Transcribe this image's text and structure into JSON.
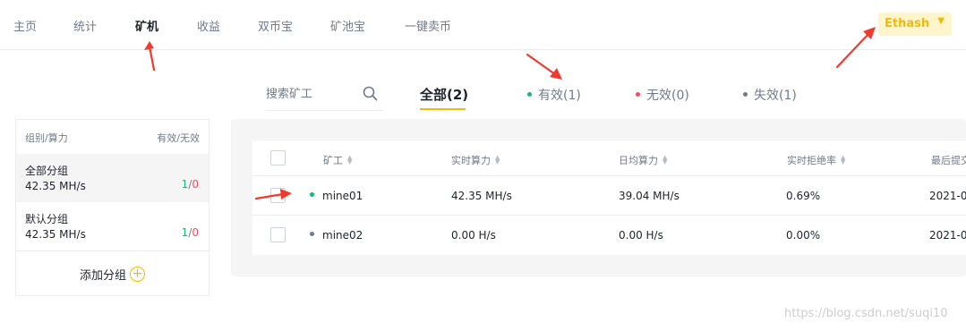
{
  "nav": {
    "items": [
      "主页",
      "统计",
      "矿机",
      "收益",
      "双币宝",
      "矿池宝",
      "一键卖币"
    ],
    "active": "矿机"
  },
  "algo_select": {
    "value": "Ethash"
  },
  "search": {
    "placeholder": "搜索矿工"
  },
  "filter_tabs": [
    {
      "label": "全部(2)",
      "active": true
    },
    {
      "label": "有效(1)",
      "dot_color": "#02c076"
    },
    {
      "label": "无效(0)",
      "dot_color": "#f84960"
    },
    {
      "label": "失效(1)",
      "dot_color": "#707a8a"
    }
  ],
  "groups": {
    "header_left": "组别/算力",
    "header_right": "有效/无效",
    "items": [
      {
        "name": "全部分组",
        "rate": "42.35 MH/s",
        "valid": "1",
        "sep": "/",
        "invalid": "0"
      },
      {
        "name": "默认分组",
        "rate": "42.35 MH/s",
        "valid": "1",
        "sep": "/",
        "invalid": "0"
      }
    ],
    "add_label": "添加分组"
  },
  "table": {
    "columns": [
      "矿工",
      "实时算力",
      "日均算力",
      "实时拒绝率",
      "最后提交"
    ],
    "rows": [
      {
        "worker": "mine01",
        "status_color": "#02c076",
        "realtime": "42.35 MH/s",
        "daily": "39.04 MH/s",
        "reject": "0.69%",
        "last": "2021-0"
      },
      {
        "worker": "mine02",
        "status_color": "#707a8a",
        "realtime": "0.00 H/s",
        "daily": "0.00 H/s",
        "reject": "0.00%",
        "last": "2021-0"
      }
    ]
  },
  "watermark": "https://blog.csdn.net/suqi10",
  "colors": {
    "accent": "#f0b90b",
    "valid": "#02c076",
    "invalid": "#f84960",
    "arrow": "#f03a2e"
  }
}
